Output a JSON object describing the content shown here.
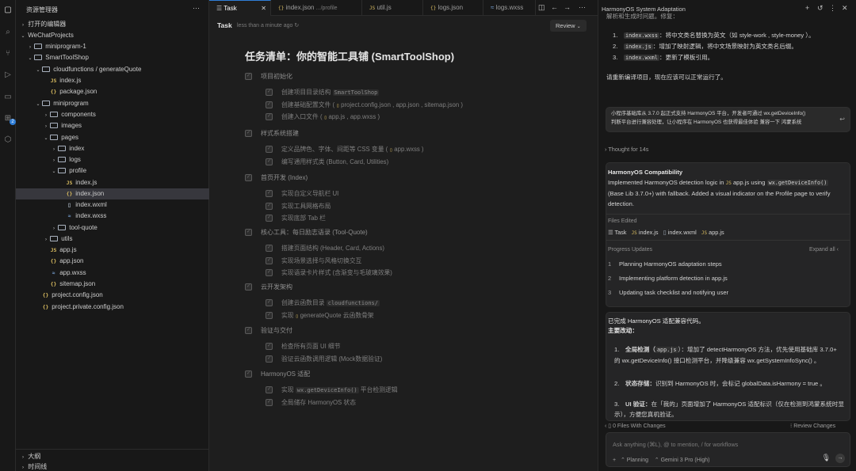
{
  "explorer": {
    "title": "资源管理器",
    "open_editors": "打开的编辑器",
    "tree": [
      {
        "label": "WeChatProjects",
        "type": "root"
      },
      {
        "label": "miniprogram-1",
        "type": "folder"
      },
      {
        "label": "SmartToolShop",
        "type": "folder"
      },
      {
        "label": "cloudfunctions / generateQuote",
        "type": "folder"
      },
      {
        "label": "index.js",
        "type": "js"
      },
      {
        "label": "package.json",
        "type": "json"
      },
      {
        "label": "miniprogram",
        "type": "folder"
      },
      {
        "label": "components",
        "type": "folder"
      },
      {
        "label": "images",
        "type": "folder"
      },
      {
        "label": "pages",
        "type": "folder"
      },
      {
        "label": "index",
        "type": "folder"
      },
      {
        "label": "logs",
        "type": "folder"
      },
      {
        "label": "profile",
        "type": "folder"
      },
      {
        "label": "index.js",
        "type": "js"
      },
      {
        "label": "index.json",
        "type": "json"
      },
      {
        "label": "index.wxml",
        "type": "wxml"
      },
      {
        "label": "index.wxss",
        "type": "wxss"
      },
      {
        "label": "tool-quote",
        "type": "folder"
      },
      {
        "label": "utils",
        "type": "folder"
      },
      {
        "label": "app.js",
        "type": "js"
      },
      {
        "label": "app.json",
        "type": "json"
      },
      {
        "label": "app.wxss",
        "type": "wxss"
      },
      {
        "label": "sitemap.json",
        "type": "json"
      },
      {
        "label": "project.config.json",
        "type": "json"
      },
      {
        "label": "project.private.config.json",
        "type": "json"
      }
    ],
    "outline": "大纲",
    "timeline": "时间线"
  },
  "tabs": [
    {
      "label": "Task",
      "sub": ""
    },
    {
      "label": "index.json",
      "sub": ".../profile"
    },
    {
      "label": "util.js",
      "sub": ""
    },
    {
      "label": "logs.json",
      "sub": ""
    },
    {
      "label": "logs.wxss",
      "sub": ""
    }
  ],
  "task": {
    "title": "Task",
    "time": "less than a minute ago",
    "review": "Review",
    "doc_title": "任务清单：你的智能工具铺 (SmartToolShop)",
    "sections": [
      {
        "title": "项目初始化",
        "items": [
          {
            "pre": "创建项目目录结构",
            "code": "SmartToolShop",
            "post": ""
          },
          {
            "pre": "创建基础配置文件 (",
            "code": "",
            "post": "project.config.json , app.json , sitemap.json )"
          },
          {
            "pre": "创建入口文件 (",
            "code": "",
            "post": "app.js , app.wxss )"
          }
        ]
      },
      {
        "title": "样式系统搭建",
        "items": [
          {
            "pre": "定义品牌色、字体、间距等 CSS 变量 (",
            "code": "",
            "post": "app.wxss )"
          },
          {
            "pre": "编写通用样式类 (Button, Card, Utilities)",
            "code": "",
            "post": ""
          }
        ]
      },
      {
        "title": "首页开发 (Index)",
        "items": [
          {
            "pre": "实现自定义导航栏 UI",
            "code": "",
            "post": ""
          },
          {
            "pre": "实现工具网格布局",
            "code": "",
            "post": ""
          },
          {
            "pre": "实现底部 Tab 栏",
            "code": "",
            "post": ""
          }
        ]
      },
      {
        "title": "核心工具：每日励志语录 (Tool-Quote)",
        "items": [
          {
            "pre": "搭建页面结构 (Header, Card, Actions)",
            "code": "",
            "post": ""
          },
          {
            "pre": "实现场景选择与风格切换交互",
            "code": "",
            "post": ""
          },
          {
            "pre": "实现语录卡片样式 (含渐变与毛玻璃效果)",
            "code": "",
            "post": ""
          }
        ]
      },
      {
        "title": "云开发架构",
        "items": [
          {
            "pre": "创建云函数目录",
            "code": "cloudfunctions/",
            "post": ""
          },
          {
            "pre": "实现",
            "code": "",
            "post": "generateQuote 云函数骨架"
          }
        ]
      },
      {
        "title": "验证与交付",
        "items": [
          {
            "pre": "检查所有页面 UI 细节",
            "code": "",
            "post": ""
          },
          {
            "pre": "验证云函数调用逻辑 (Mock数据验证)",
            "code": "",
            "post": ""
          }
        ]
      },
      {
        "title": "HarmonyOS 适配",
        "items": [
          {
            "pre": "实现",
            "code": "wx.getDeviceInfo()",
            "post": "平台检测逻辑"
          },
          {
            "pre": "全局储存 HarmonyOS 状态",
            "code": "",
            "post": ""
          }
        ]
      }
    ]
  },
  "panel": {
    "title": "HarmonyOS System Adaptation",
    "top_cut": "解析和生成时问题。修复：",
    "fixes": [
      {
        "n": "1.",
        "code": "index.wxss",
        "text": "：将中文类名替换为英文（如 style-work , style-money ）。"
      },
      {
        "n": "2.",
        "code": "index.js",
        "text": "：增加了映射逻辑，将中文场景映射为英文类名后缀。"
      },
      {
        "n": "3.",
        "code": "index.wxml",
        "text": "：更新了模板引用。"
      }
    ],
    "fix_done": "请重新编译项目，现在应该可以正常运行了。",
    "user_msg_1": "小程序基础库从 3.7.0 起正式支持 HarmonyOS 平台，开发者可通过 wx.getDeviceInfo()",
    "user_msg_2": "判断平台进行兼容处理，让小程序在 HarmonyOS 也获得最佳体验 兼容一下 鸿蒙系统",
    "thought": "Thought for 14s",
    "card_title": "HarmonyOS Compatibility",
    "card_body_1": "Implemented HarmonyOS detection logic in",
    "card_file": "app.js",
    "card_body_2": "using",
    "card_code": "wx.getDeviceInfo()",
    "card_body_3": "(Base Lib 3.7.0+) with fallback. Added a visual indicator on the Profile",
    "card_body_4": "page to verify detection.",
    "files_edited": "Files Edited",
    "files": [
      "Task",
      "index.js",
      "index.wxml",
      "app.js"
    ],
    "progress_label": "Progress Updates",
    "expand": "Expand all",
    "progress": [
      {
        "n": "1",
        "text": "Planning HarmonyOS adaptation steps"
      },
      {
        "n": "2",
        "text": "Implementing platform detection in app.js"
      },
      {
        "n": "3",
        "text": "Updating task checklist and notifying user"
      }
    ],
    "done_title": "已完成 HarmonyOS 适配兼容代码。",
    "done_sub": "主要改动：",
    "done_items": [
      {
        "n": "1.",
        "bold": "全局检测（",
        "code": "app.js",
        "text": "）：增加了 detectHarmonyOS 方法，优先使用基础库 3.7.0+ 的 wx.getDeviceInfo() 接口检测平台，并降级兼容 wx.getSystemInfoSync() 。"
      },
      {
        "n": "2.",
        "bold": "状态存储：",
        "code": "",
        "text": "识别到 HarmonyOS 时，会标记 globalData.isHarmony = true 。"
      },
      {
        "n": "3.",
        "bold": "UI 验证：",
        "code": "",
        "text": "在「我的」页面增加了 HarmonyOS 适配标识（仅在检测到鸿蒙系统时显示），方便您真机验证。"
      }
    ],
    "files_changes": "0 Files With Changes",
    "review_changes": "Review Changes",
    "input_placeholder": "Ask anything (⌘L), @ to mention, / for workflows",
    "planning": "Planning",
    "model": "Gemini 3 Pro (High)"
  }
}
